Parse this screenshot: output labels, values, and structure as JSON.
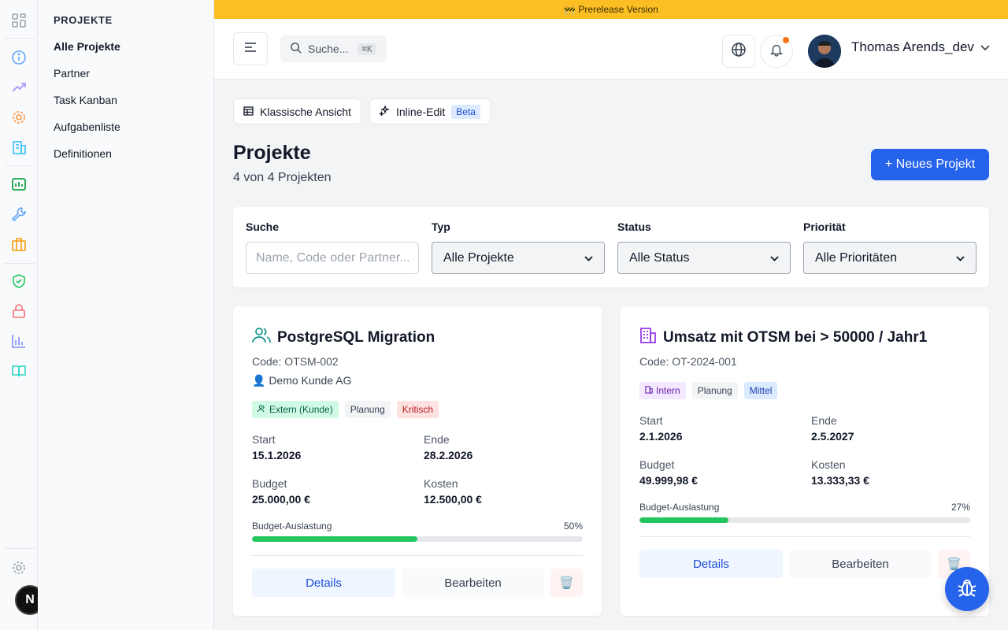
{
  "rail": {
    "icons": [
      "grid-icon",
      "info-icon",
      "trending-up-icon",
      "gear-icon",
      "building-icon",
      "chart-icon",
      "wrench-icon",
      "briefcase-icon",
      "shield-check-icon",
      "lock-icon",
      "bar-chart-icon",
      "book-icon",
      "settings-icon"
    ],
    "colors": {
      "grid": "#9ca3af",
      "info": "#60a5fa",
      "trend": "#a78bfa",
      "gear": "#fb923c",
      "building": "#38bdf8",
      "chart": "#16a34a",
      "wrench": "#60a5fa",
      "briefcase": "#f59e0b",
      "shield": "#22c55e",
      "lock": "#f87171",
      "bar": "#818cf8",
      "book": "#2dd4bf"
    },
    "nextjs_label": "N"
  },
  "subnav": {
    "heading": "PROJEKTE",
    "items": [
      "Alle Projekte",
      "Partner",
      "Task Kanban",
      "Aufgabenliste",
      "Definitionen"
    ]
  },
  "banner": {
    "text": "🚧 Prerelease Version"
  },
  "topbar": {
    "search_label": "Suche...",
    "search_shortcut": "⌘K",
    "user_name": "Thomas Arends_dev"
  },
  "views": {
    "classic_label": "Klassische Ansicht",
    "inline_label": "Inline-Edit",
    "beta_label": "Beta"
  },
  "page": {
    "title": "Projekte",
    "subtitle": "4 von 4 Projekten",
    "new_button": "+ Neues Projekt"
  },
  "filters": {
    "search_label": "Suche",
    "search_placeholder": "Name, Code oder Partner...",
    "type_label": "Typ",
    "type_value": "Alle Projekte",
    "status_label": "Status",
    "status_value": "Alle Status",
    "priority_label": "Priorität",
    "priority_value": "Alle Prioritäten"
  },
  "labels": {
    "start": "Start",
    "end": "Ende",
    "budget": "Budget",
    "costs": "Kosten",
    "utilization": "Budget-Auslastung",
    "details": "Details",
    "edit": "Bearbeiten",
    "delete": "🗑️"
  },
  "projects": [
    {
      "title": "PostgreSQL Migration",
      "code": "Code: OTSM-002",
      "partner": "👤 Demo Kunde AG",
      "type_badge": "Extern (Kunde)",
      "status_badge": "Planung",
      "priority_badge": "Kritisch",
      "start": "15.1.2026",
      "end": "28.2.2026",
      "budget": "25.000,00 €",
      "costs": "12.500,00 €",
      "utilization_pct": "50%",
      "utilization": 0.5
    },
    {
      "title": "Umsatz mit OTSM bei > 50000 / Jahr1",
      "code": "Code: OT-2024-001",
      "type_badge": "Intern",
      "status_badge": "Planung",
      "priority_badge": "Mittel",
      "start": "2.1.2026",
      "end": "2.5.2027",
      "budget": "49.999,98 €",
      "costs": "13.333,33 €",
      "utilization_pct": "27%",
      "utilization": 0.27
    }
  ],
  "colors": {
    "accent": "#2563eb",
    "banner": "#fbbf24",
    "progress": "#22c55e"
  }
}
